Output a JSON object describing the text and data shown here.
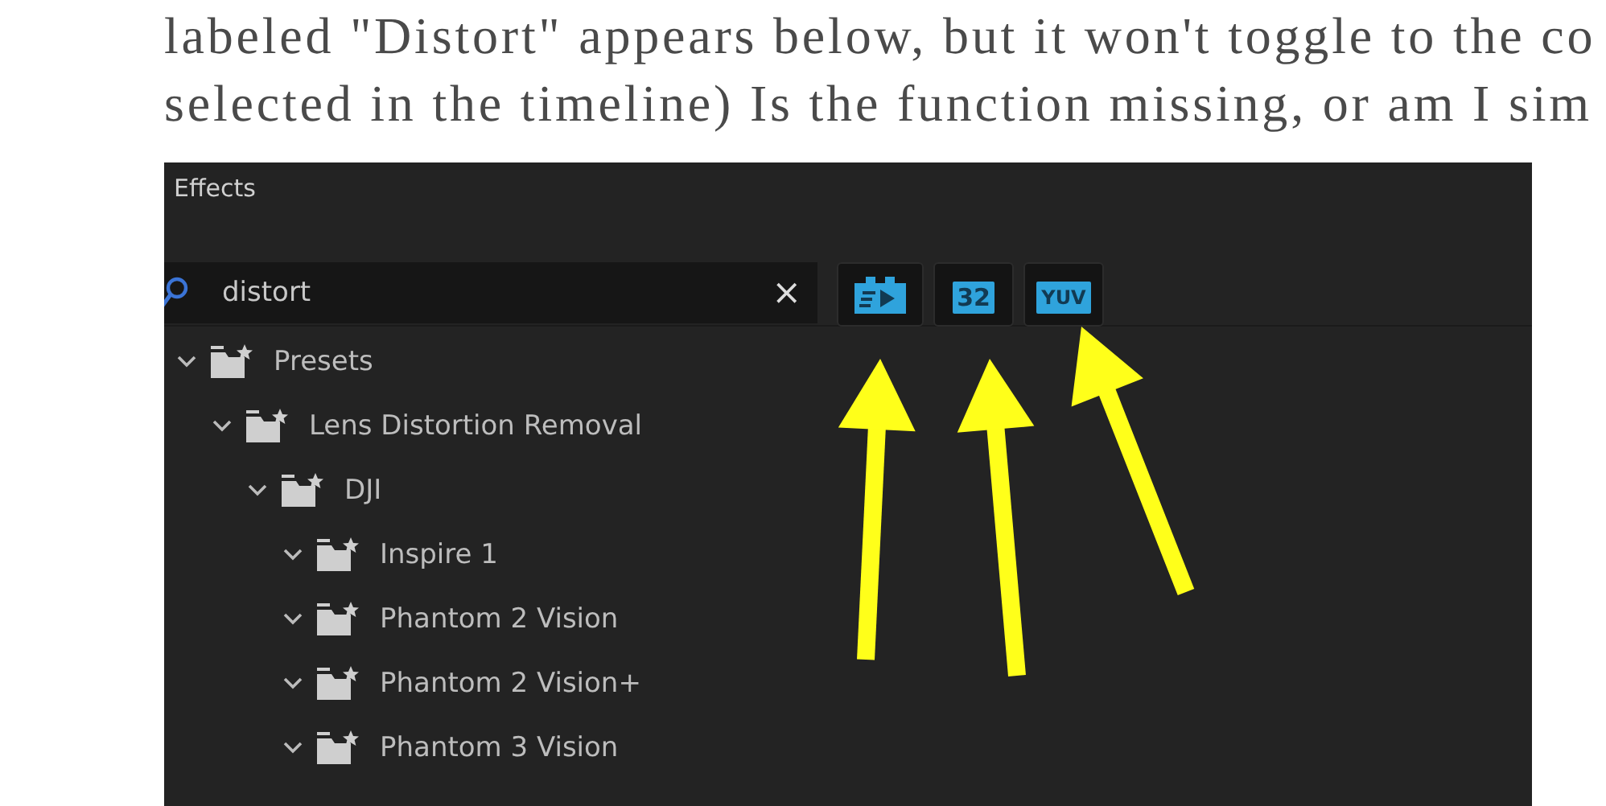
{
  "post_text": [
    "labeled \"Distort\" appears below, but it won't toggle to the co",
    "selected in the timeline) Is the function missing, or am I sim"
  ],
  "panel": {
    "title": "Effects",
    "search": {
      "value": "distort",
      "clear": "×"
    },
    "filter_buttons": [
      {
        "kind": "icon"
      },
      {
        "kind": "text",
        "label": "32"
      },
      {
        "kind": "text",
        "label": "YUV"
      }
    ],
    "tree": [
      {
        "label": "Presets",
        "expanded": true,
        "children": [
          {
            "label": "Lens Distortion Removal",
            "expanded": true,
            "children": [
              {
                "label": "DJI",
                "expanded": true,
                "children": [
                  {
                    "label": "Inspire 1",
                    "expanded": true
                  },
                  {
                    "label": "Phantom 2 Vision",
                    "expanded": true
                  },
                  {
                    "label": "Phantom 2 Vision+",
                    "expanded": true
                  },
                  {
                    "label": "Phantom 3 Vision",
                    "expanded": true
                  }
                ]
              }
            ]
          }
        ]
      }
    ]
  },
  "annotations": [
    {
      "kind": "arrow"
    },
    {
      "kind": "arrow"
    },
    {
      "kind": "arrow"
    }
  ]
}
